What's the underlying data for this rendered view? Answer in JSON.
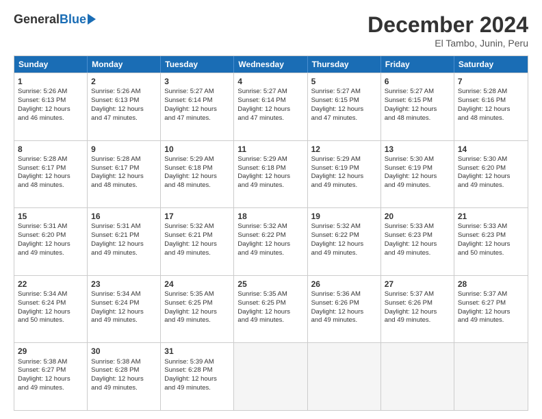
{
  "logo": {
    "general": "General",
    "blue": "Blue"
  },
  "title": "December 2024",
  "subtitle": "El Tambo, Junin, Peru",
  "days": [
    "Sunday",
    "Monday",
    "Tuesday",
    "Wednesday",
    "Thursday",
    "Friday",
    "Saturday"
  ],
  "weeks": [
    [
      {
        "num": "1",
        "sunrise": "Sunrise: 5:26 AM",
        "sunset": "Sunset: 6:13 PM",
        "daylight": "Daylight: 12 hours",
        "minutes": "and 46 minutes."
      },
      {
        "num": "2",
        "sunrise": "Sunrise: 5:26 AM",
        "sunset": "Sunset: 6:13 PM",
        "daylight": "Daylight: 12 hours",
        "minutes": "and 47 minutes."
      },
      {
        "num": "3",
        "sunrise": "Sunrise: 5:27 AM",
        "sunset": "Sunset: 6:14 PM",
        "daylight": "Daylight: 12 hours",
        "minutes": "and 47 minutes."
      },
      {
        "num": "4",
        "sunrise": "Sunrise: 5:27 AM",
        "sunset": "Sunset: 6:14 PM",
        "daylight": "Daylight: 12 hours",
        "minutes": "and 47 minutes."
      },
      {
        "num": "5",
        "sunrise": "Sunrise: 5:27 AM",
        "sunset": "Sunset: 6:15 PM",
        "daylight": "Daylight: 12 hours",
        "minutes": "and 47 minutes."
      },
      {
        "num": "6",
        "sunrise": "Sunrise: 5:27 AM",
        "sunset": "Sunset: 6:15 PM",
        "daylight": "Daylight: 12 hours",
        "minutes": "and 48 minutes."
      },
      {
        "num": "7",
        "sunrise": "Sunrise: 5:28 AM",
        "sunset": "Sunset: 6:16 PM",
        "daylight": "Daylight: 12 hours",
        "minutes": "and 48 minutes."
      }
    ],
    [
      {
        "num": "8",
        "sunrise": "Sunrise: 5:28 AM",
        "sunset": "Sunset: 6:17 PM",
        "daylight": "Daylight: 12 hours",
        "minutes": "and 48 minutes."
      },
      {
        "num": "9",
        "sunrise": "Sunrise: 5:28 AM",
        "sunset": "Sunset: 6:17 PM",
        "daylight": "Daylight: 12 hours",
        "minutes": "and 48 minutes."
      },
      {
        "num": "10",
        "sunrise": "Sunrise: 5:29 AM",
        "sunset": "Sunset: 6:18 PM",
        "daylight": "Daylight: 12 hours",
        "minutes": "and 48 minutes."
      },
      {
        "num": "11",
        "sunrise": "Sunrise: 5:29 AM",
        "sunset": "Sunset: 6:18 PM",
        "daylight": "Daylight: 12 hours",
        "minutes": "and 49 minutes."
      },
      {
        "num": "12",
        "sunrise": "Sunrise: 5:29 AM",
        "sunset": "Sunset: 6:19 PM",
        "daylight": "Daylight: 12 hours",
        "minutes": "and 49 minutes."
      },
      {
        "num": "13",
        "sunrise": "Sunrise: 5:30 AM",
        "sunset": "Sunset: 6:19 PM",
        "daylight": "Daylight: 12 hours",
        "minutes": "and 49 minutes."
      },
      {
        "num": "14",
        "sunrise": "Sunrise: 5:30 AM",
        "sunset": "Sunset: 6:20 PM",
        "daylight": "Daylight: 12 hours",
        "minutes": "and 49 minutes."
      }
    ],
    [
      {
        "num": "15",
        "sunrise": "Sunrise: 5:31 AM",
        "sunset": "Sunset: 6:20 PM",
        "daylight": "Daylight: 12 hours",
        "minutes": "and 49 minutes."
      },
      {
        "num": "16",
        "sunrise": "Sunrise: 5:31 AM",
        "sunset": "Sunset: 6:21 PM",
        "daylight": "Daylight: 12 hours",
        "minutes": "and 49 minutes."
      },
      {
        "num": "17",
        "sunrise": "Sunrise: 5:32 AM",
        "sunset": "Sunset: 6:21 PM",
        "daylight": "Daylight: 12 hours",
        "minutes": "and 49 minutes."
      },
      {
        "num": "18",
        "sunrise": "Sunrise: 5:32 AM",
        "sunset": "Sunset: 6:22 PM",
        "daylight": "Daylight: 12 hours",
        "minutes": "and 49 minutes."
      },
      {
        "num": "19",
        "sunrise": "Sunrise: 5:32 AM",
        "sunset": "Sunset: 6:22 PM",
        "daylight": "Daylight: 12 hours",
        "minutes": "and 49 minutes."
      },
      {
        "num": "20",
        "sunrise": "Sunrise: 5:33 AM",
        "sunset": "Sunset: 6:23 PM",
        "daylight": "Daylight: 12 hours",
        "minutes": "and 49 minutes."
      },
      {
        "num": "21",
        "sunrise": "Sunrise: 5:33 AM",
        "sunset": "Sunset: 6:23 PM",
        "daylight": "Daylight: 12 hours",
        "minutes": "and 50 minutes."
      }
    ],
    [
      {
        "num": "22",
        "sunrise": "Sunrise: 5:34 AM",
        "sunset": "Sunset: 6:24 PM",
        "daylight": "Daylight: 12 hours",
        "minutes": "and 50 minutes."
      },
      {
        "num": "23",
        "sunrise": "Sunrise: 5:34 AM",
        "sunset": "Sunset: 6:24 PM",
        "daylight": "Daylight: 12 hours",
        "minutes": "and 49 minutes."
      },
      {
        "num": "24",
        "sunrise": "Sunrise: 5:35 AM",
        "sunset": "Sunset: 6:25 PM",
        "daylight": "Daylight: 12 hours",
        "minutes": "and 49 minutes."
      },
      {
        "num": "25",
        "sunrise": "Sunrise: 5:35 AM",
        "sunset": "Sunset: 6:25 PM",
        "daylight": "Daylight: 12 hours",
        "minutes": "and 49 minutes."
      },
      {
        "num": "26",
        "sunrise": "Sunrise: 5:36 AM",
        "sunset": "Sunset: 6:26 PM",
        "daylight": "Daylight: 12 hours",
        "minutes": "and 49 minutes."
      },
      {
        "num": "27",
        "sunrise": "Sunrise: 5:37 AM",
        "sunset": "Sunset: 6:26 PM",
        "daylight": "Daylight: 12 hours",
        "minutes": "and 49 minutes."
      },
      {
        "num": "28",
        "sunrise": "Sunrise: 5:37 AM",
        "sunset": "Sunset: 6:27 PM",
        "daylight": "Daylight: 12 hours",
        "minutes": "and 49 minutes."
      }
    ],
    [
      {
        "num": "29",
        "sunrise": "Sunrise: 5:38 AM",
        "sunset": "Sunset: 6:27 PM",
        "daylight": "Daylight: 12 hours",
        "minutes": "and 49 minutes."
      },
      {
        "num": "30",
        "sunrise": "Sunrise: 5:38 AM",
        "sunset": "Sunset: 6:28 PM",
        "daylight": "Daylight: 12 hours",
        "minutes": "and 49 minutes."
      },
      {
        "num": "31",
        "sunrise": "Sunrise: 5:39 AM",
        "sunset": "Sunset: 6:28 PM",
        "daylight": "Daylight: 12 hours",
        "minutes": "and 49 minutes."
      },
      null,
      null,
      null,
      null
    ]
  ]
}
